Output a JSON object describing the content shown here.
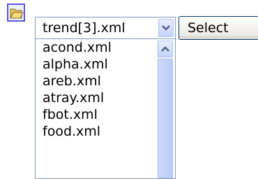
{
  "toolbar": {
    "open_icon": "folder-open-icon"
  },
  "file_select": {
    "value": "trend[3].xml",
    "dropdown_icon": "chevron-down-icon"
  },
  "select_button": {
    "label": "Select"
  },
  "file_list": {
    "items": [
      "acond.xml",
      "alpha.xml",
      "areb.xml",
      "atray.xml",
      "fbot.xml",
      "food.xml"
    ],
    "scroll_up_icon": "chevron-up-icon"
  },
  "colors": {
    "accent": "#5a57d8",
    "border": "#7f9db9",
    "scroll_button": "#c3d3fd"
  }
}
